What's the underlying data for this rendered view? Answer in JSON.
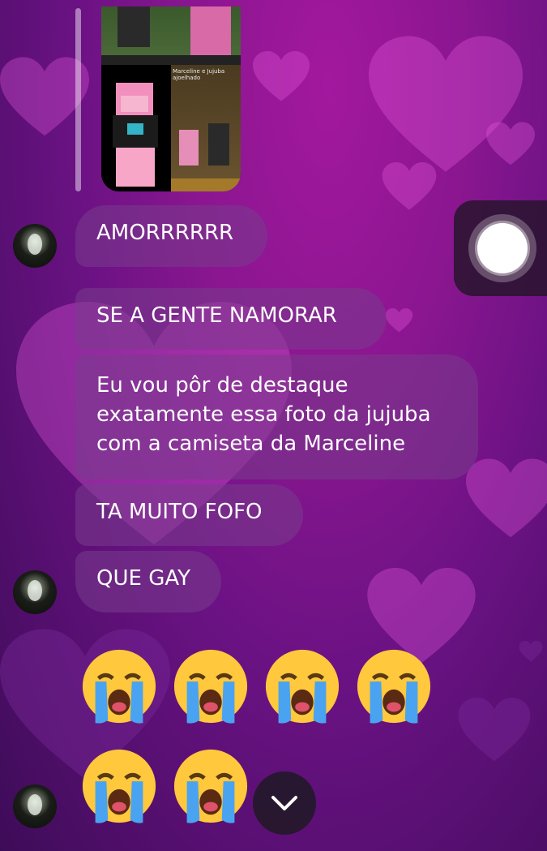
{
  "media": {
    "caption": "Marceline e Jujuba ajoelhado"
  },
  "messages": [
    {
      "id": "msg1",
      "text": "AMORRRRRR"
    },
    {
      "id": "msg2",
      "text": "SE A GENTE NAMORAR"
    },
    {
      "id": "msg3",
      "lines": [
        "Eu vou pôr de destaque",
        "exatamente essa foto da jujuba",
        "com a camiseta da Marceline"
      ]
    },
    {
      "id": "msg4",
      "text": "TA MUITO FOFO"
    },
    {
      "id": "msg5",
      "text": "QUE GAY"
    }
  ],
  "emoji_rows": [
    {
      "count": 4,
      "emoji": "loudly-crying-face"
    },
    {
      "count": 2,
      "emoji": "loudly-crying-face"
    }
  ],
  "controls": {
    "assistive_touch": "assistive-touch-icon",
    "scroll_down": "chevron-down-icon"
  },
  "colors": {
    "bubble": "#7a3c8c",
    "background_top": "#a3189e",
    "background_bottom": "#3d0c58"
  }
}
